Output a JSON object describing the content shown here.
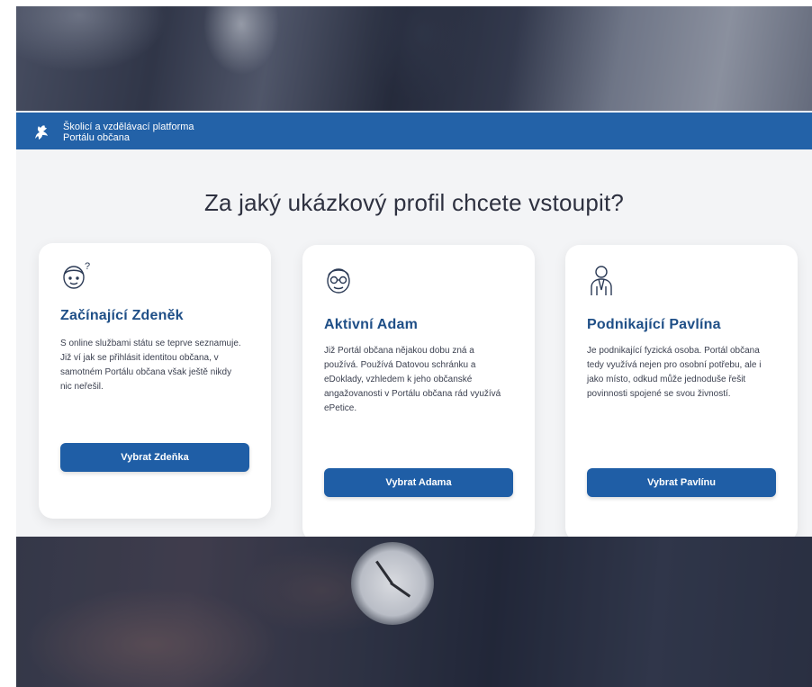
{
  "header": {
    "brand_line1": "Školicí a vzdělávací platforma",
    "brand_line2": "Portálu občana"
  },
  "main": {
    "heading": "Za jaký ukázkový profil chcete vstoupit?"
  },
  "profiles": [
    {
      "icon": "beginner-user-icon",
      "title": "Začínající Zdeněk",
      "description": "S online službami státu se teprve seznamuje. Již ví jak se přihlásit identitou občana, v samotném Portálu občana však ještě nikdy nic neřešil.",
      "button": "Vybrat Zdeňka"
    },
    {
      "icon": "active-user-icon",
      "title": "Aktivní Adam",
      "description": "Již Portál občana nějakou dobu zná a používá. Používá Datovou schránku a eDoklady, vzhledem k jeho občanské angažovanosti v Portálu občana rád využívá ePetice.",
      "button": "Vybrat Adama"
    },
    {
      "icon": "business-user-icon",
      "title": "Podnikající Pavlína",
      "description": "Je podnikající fyzická osoba. Portál občana tedy využívá nejen pro osobní potřebu, ale i jako místo, odkud může jednoduše řešit povinnosti spojené se svou živností.",
      "button": "Vybrat Pavlínu"
    }
  ],
  "colors": {
    "brand_blue": "#2362a8",
    "title_blue": "#1f4f87",
    "button_blue": "#1f5ea6",
    "panel_bg": "#f3f4f6"
  }
}
